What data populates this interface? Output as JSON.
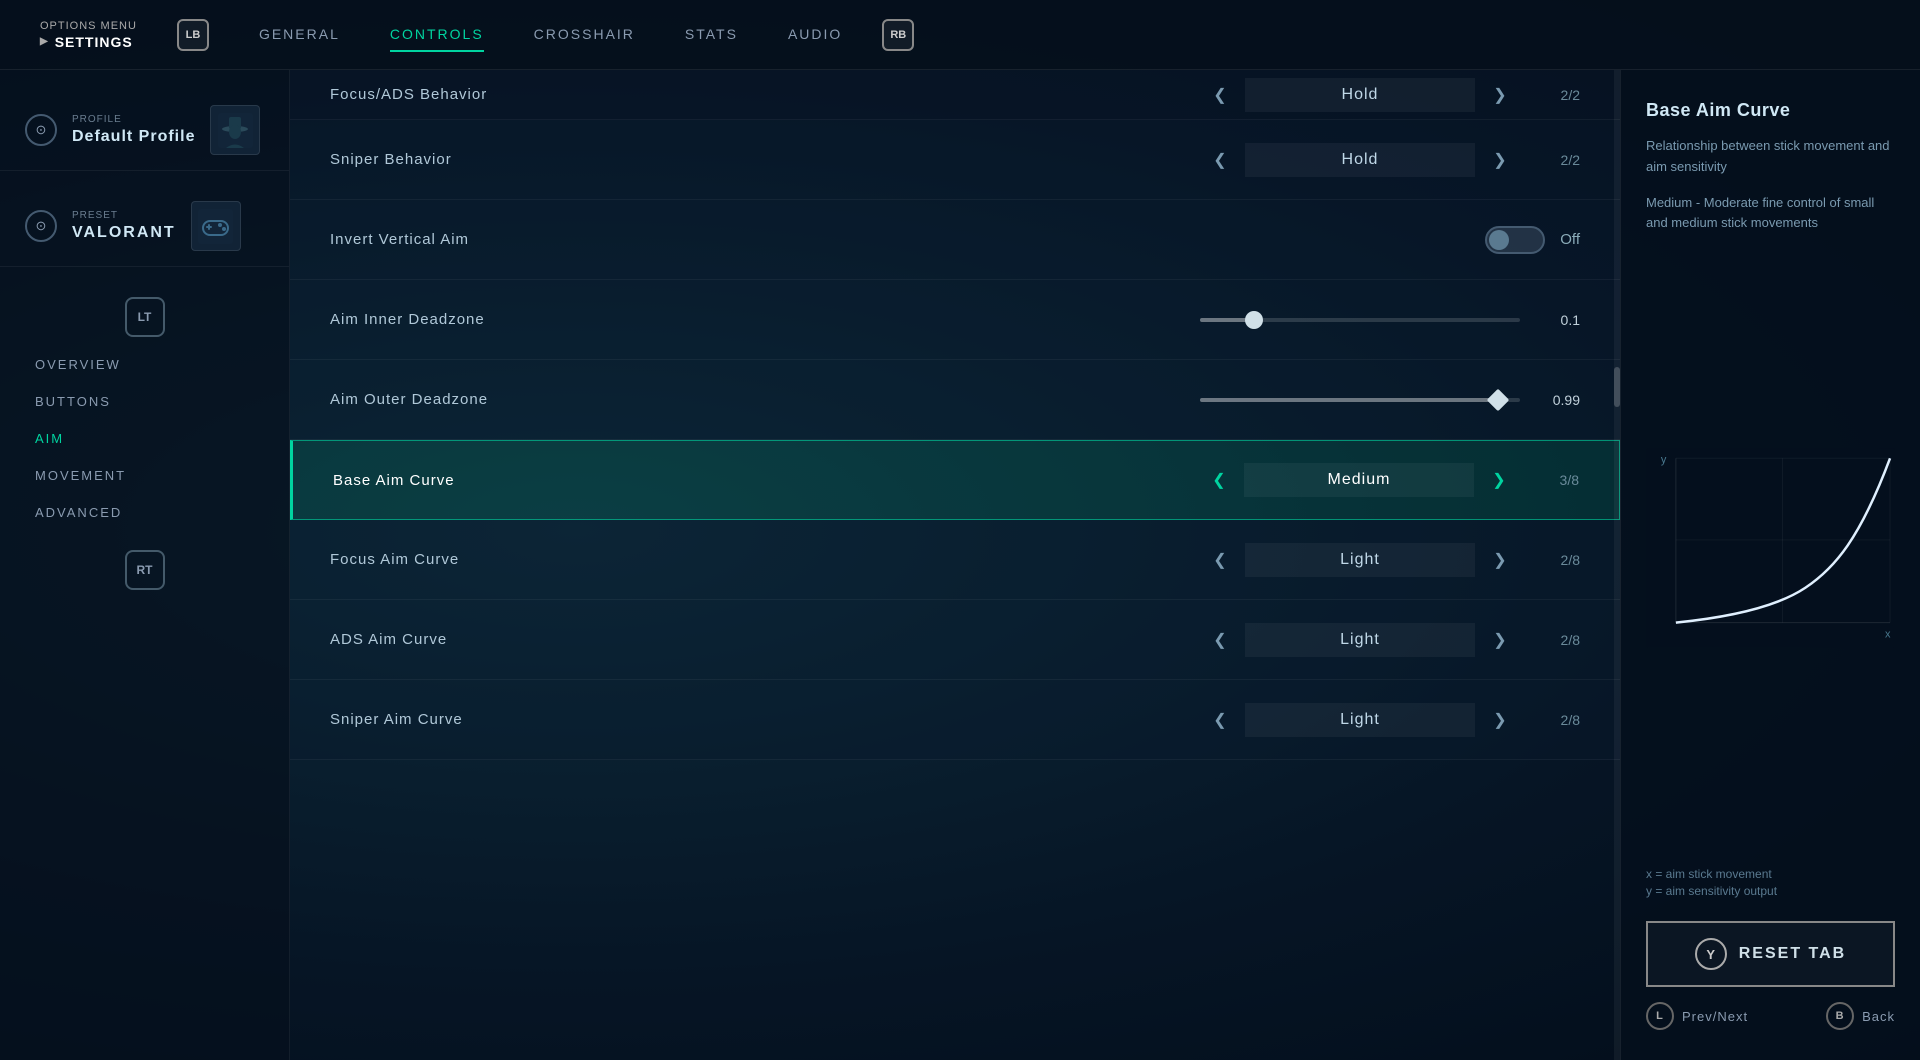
{
  "topNav": {
    "optionsMenuLabel": "OPTIONS MENU",
    "settingsLabel": "SETTINGS",
    "lbLabel": "LB",
    "rbLabel": "RB",
    "tabs": [
      {
        "id": "general",
        "label": "GENERAL",
        "active": false
      },
      {
        "id": "controls",
        "label": "CONTROLS",
        "active": true
      },
      {
        "id": "crosshair",
        "label": "CROSSHAIR",
        "active": false
      },
      {
        "id": "stats",
        "label": "STATS",
        "active": false
      },
      {
        "id": "audio",
        "label": "AUDIO",
        "active": false
      }
    ]
  },
  "sidebar": {
    "profile": {
      "label": "PROFILE",
      "name": "Default Profile"
    },
    "preset": {
      "label": "PRESET",
      "name": "VALORANT"
    },
    "ltLabel": "LT",
    "menuItems": [
      {
        "id": "overview",
        "label": "OVERVIEW",
        "active": false
      },
      {
        "id": "buttons",
        "label": "BUTTONS",
        "active": false
      },
      {
        "id": "aim",
        "label": "AIM",
        "active": true
      },
      {
        "id": "movement",
        "label": "MOVEMENT",
        "active": false
      },
      {
        "id": "advanced",
        "label": "ADVANCED",
        "active": false
      }
    ],
    "rtLabel": "RT"
  },
  "settings": {
    "rows": [
      {
        "id": "focus-ads-behavior",
        "label": "Focus/ADS Behavior",
        "type": "selector",
        "value": "Hold",
        "count": "2/2",
        "highlighted": false,
        "partial": true
      },
      {
        "id": "sniper-behavior",
        "label": "Sniper Behavior",
        "type": "selector",
        "value": "Hold",
        "count": "2/2",
        "highlighted": false
      },
      {
        "id": "invert-vertical-aim",
        "label": "Invert Vertical Aim",
        "type": "toggle",
        "value": "Off",
        "highlighted": false
      },
      {
        "id": "aim-inner-deadzone",
        "label": "Aim Inner Deadzone",
        "type": "slider",
        "value": "0.1",
        "sliderPos": 17,
        "sliderType": "round",
        "highlighted": false
      },
      {
        "id": "aim-outer-deadzone",
        "label": "Aim Outer Deadzone",
        "type": "slider",
        "value": "0.99",
        "sliderPos": 93,
        "sliderType": "diamond",
        "highlighted": false
      },
      {
        "id": "base-aim-curve",
        "label": "Base Aim Curve",
        "type": "selector",
        "value": "Medium",
        "count": "3/8",
        "highlighted": true
      },
      {
        "id": "focus-aim-curve",
        "label": "Focus Aim Curve",
        "type": "selector",
        "value": "Light",
        "count": "2/8",
        "highlighted": false
      },
      {
        "id": "ads-aim-curve",
        "label": "ADS Aim Curve",
        "type": "selector",
        "value": "Light",
        "count": "2/8",
        "highlighted": false
      },
      {
        "id": "sniper-aim-curve",
        "label": "Sniper Aim Curve",
        "type": "selector",
        "value": "Light",
        "count": "2/8",
        "highlighted": false
      }
    ]
  },
  "rightPanel": {
    "title": "Base Aim Curve",
    "description": "Relationship between stick movement and aim sensitivity",
    "subdescription": "Medium - Moderate fine control of small and medium stick movements",
    "chart": {
      "xLabel": "x",
      "yLabel": "y",
      "xAxisDesc": "x = aim stick movement",
      "yAxisDesc": "y = aim sensitivity output"
    },
    "resetTabBtn": "RESET TAB",
    "yBtnLabel": "Y",
    "bottomControls": {
      "prevNextLabel": "Prev/Next",
      "lBtnLabel": "L",
      "backLabel": "Back",
      "bBtnLabel": "B"
    }
  }
}
